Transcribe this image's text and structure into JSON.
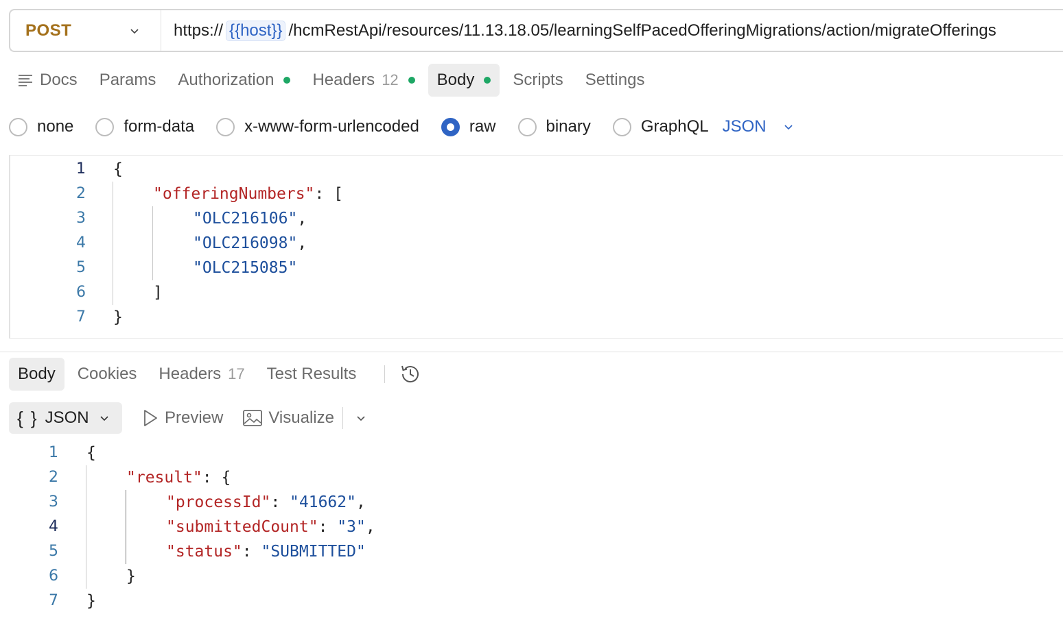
{
  "request": {
    "method": "POST",
    "url_prefix": "https://",
    "url_variable": "{{host}}",
    "url_path": "/hcmRestApi/resources/11.13.18.05/learningSelfPacedOfferingMigrations/action/migrateOfferings"
  },
  "request_tabs": [
    {
      "label": "Docs"
    },
    {
      "label": "Params"
    },
    {
      "label": "Authorization"
    },
    {
      "label": "Headers",
      "count": "12"
    },
    {
      "label": "Body"
    },
    {
      "label": "Scripts"
    },
    {
      "label": "Settings"
    }
  ],
  "body_types": [
    "none",
    "form-data",
    "x-www-form-urlencoded",
    "raw",
    "binary",
    "GraphQL"
  ],
  "body_format": "JSON",
  "request_body": {
    "line_numbers": [
      "1",
      "2",
      "3",
      "4",
      "5",
      "6",
      "7"
    ],
    "open_brace": "{",
    "key": "\"offeringNumbers\"",
    "key_sep": ": [",
    "values": [
      "\"OLC216106\"",
      "\"OLC216098\"",
      "\"OLC215085\""
    ],
    "comma": ",",
    "close_bracket": "]",
    "close_brace": "}"
  },
  "response_tabs": [
    {
      "label": "Body"
    },
    {
      "label": "Cookies"
    },
    {
      "label": "Headers",
      "count": "17"
    },
    {
      "label": "Test Results"
    }
  ],
  "response_toolbar": {
    "format_braces": "{ }",
    "format_label": "JSON",
    "preview_label": "Preview",
    "visualize_label": "Visualize"
  },
  "response_body": {
    "line_numbers": [
      "1",
      "2",
      "3",
      "4",
      "5",
      "6",
      "7"
    ],
    "open_brace": "{",
    "result_key": "\"result\"",
    "result_sep": ": {",
    "process_key": "\"processId\"",
    "process_val": "\"41662\"",
    "count_key": "\"submittedCount\"",
    "count_val": "\"3\"",
    "status_key": "\"status\"",
    "status_val": "\"SUBMITTED\"",
    "colon": ": ",
    "comma": ",",
    "close_inner": "}",
    "close_brace": "}"
  },
  "colors": {
    "method": "#a4711c",
    "accent": "#2f64c4",
    "status_dot": "#1ea765",
    "json_key": "#b32525",
    "json_string": "#1d4f9c"
  }
}
